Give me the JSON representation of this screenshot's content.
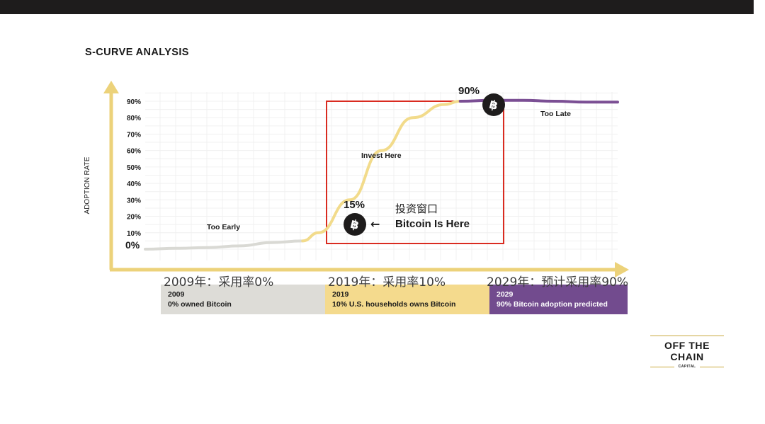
{
  "title": "S-CURVE ANALYSIS",
  "chart_data": {
    "type": "line",
    "title": "S-CURVE ANALYSIS",
    "ylabel": "ADOPTION RATE",
    "xlabel": "",
    "y_ticks": [
      "10%",
      "20%",
      "30%",
      "40%",
      "50%",
      "60%",
      "70%",
      "80%",
      "90%"
    ],
    "ylim": [
      0,
      95
    ],
    "grid": true,
    "series": [
      {
        "segment": "early",
        "color": "#d9d9d4",
        "x": [
          2009,
          2011,
          2013,
          2015,
          2017,
          2019
        ],
        "y": [
          0,
          0.5,
          1,
          2,
          4,
          5
        ]
      },
      {
        "segment": "growth",
        "color": "#f2db8b",
        "x": [
          2019,
          2020,
          2022,
          2024,
          2026,
          2028,
          2029
        ],
        "y": [
          5,
          10,
          30,
          60,
          80,
          88,
          90
        ]
      },
      {
        "segment": "late",
        "color": "#7b4f94",
        "x": [
          2029,
          2031,
          2033,
          2035,
          2037,
          2039
        ],
        "y": [
          90,
          90.5,
          90.5,
          90,
          89.5,
          89.5
        ]
      }
    ],
    "points": [
      {
        "label": "15%",
        "x": 2021,
        "y": 15
      },
      {
        "label": "90%",
        "x": 2029,
        "y": 90
      }
    ],
    "zero_label": "0%",
    "annotations": {
      "too_early": "Too Early",
      "invest_here": "Invest Here",
      "too_late": "Too Late",
      "invest_window_cn": "投资窗口",
      "bitcoin_here": "Bitcoin Is Here",
      "arrow": "←"
    },
    "highlight_box": {
      "x": [
        2019,
        2029
      ],
      "y": [
        0,
        90
      ],
      "color": "#d92b20"
    }
  },
  "timeline": [
    {
      "year": "2009",
      "text": "0% owned Bitcoin",
      "bg": "#dddcd7",
      "color": "#1a1a1a",
      "caption": "2009年：采用率0%"
    },
    {
      "year": "2019",
      "text": "10% U.S. households owns Bitcoin",
      "bg": "#f4da8d",
      "color": "#1a1a1a",
      "caption": "2019年：采用率10%"
    },
    {
      "year": "2029",
      "text": "90% Bitcoin adoption predicted",
      "bg": "#724b8e",
      "color": "#ffffff",
      "caption": "2029年：预计采用率90%"
    }
  ],
  "logo": {
    "name": "OFF THE CHAIN",
    "sub": "CAPITAL"
  },
  "icons": {
    "bitcoin": "bitcoin-icon"
  },
  "colors": {
    "axis": "#ecd27a",
    "accent_red": "#d92b20",
    "dark": "#1e1c1c"
  }
}
